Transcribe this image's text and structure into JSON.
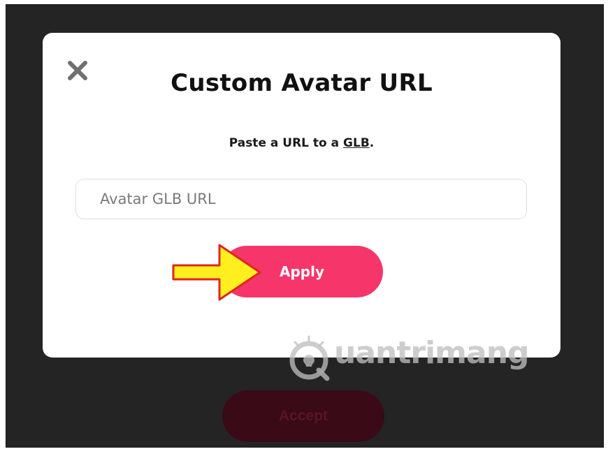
{
  "modal": {
    "title": "Custom Avatar URL",
    "subtitle_prefix": "Paste a URL to a ",
    "subtitle_link": "GLB",
    "subtitle_suffix": ".",
    "input": {
      "placeholder": "Avatar GLB URL",
      "value": ""
    },
    "apply_label": "Apply",
    "close_icon": "close-icon"
  },
  "background": {
    "accept_label": "Accept"
  },
  "watermark": {
    "text": "uantrimang",
    "icon": "lightbulb-q-logo-icon"
  },
  "annotation": {
    "icon": "pointer-arrow-icon",
    "fill_color": "#ffef1f",
    "stroke_color": "#e0261c"
  },
  "colors": {
    "accent": "#f6356a",
    "backdrop": "#242424",
    "accept_dim": "#3a0a16"
  }
}
